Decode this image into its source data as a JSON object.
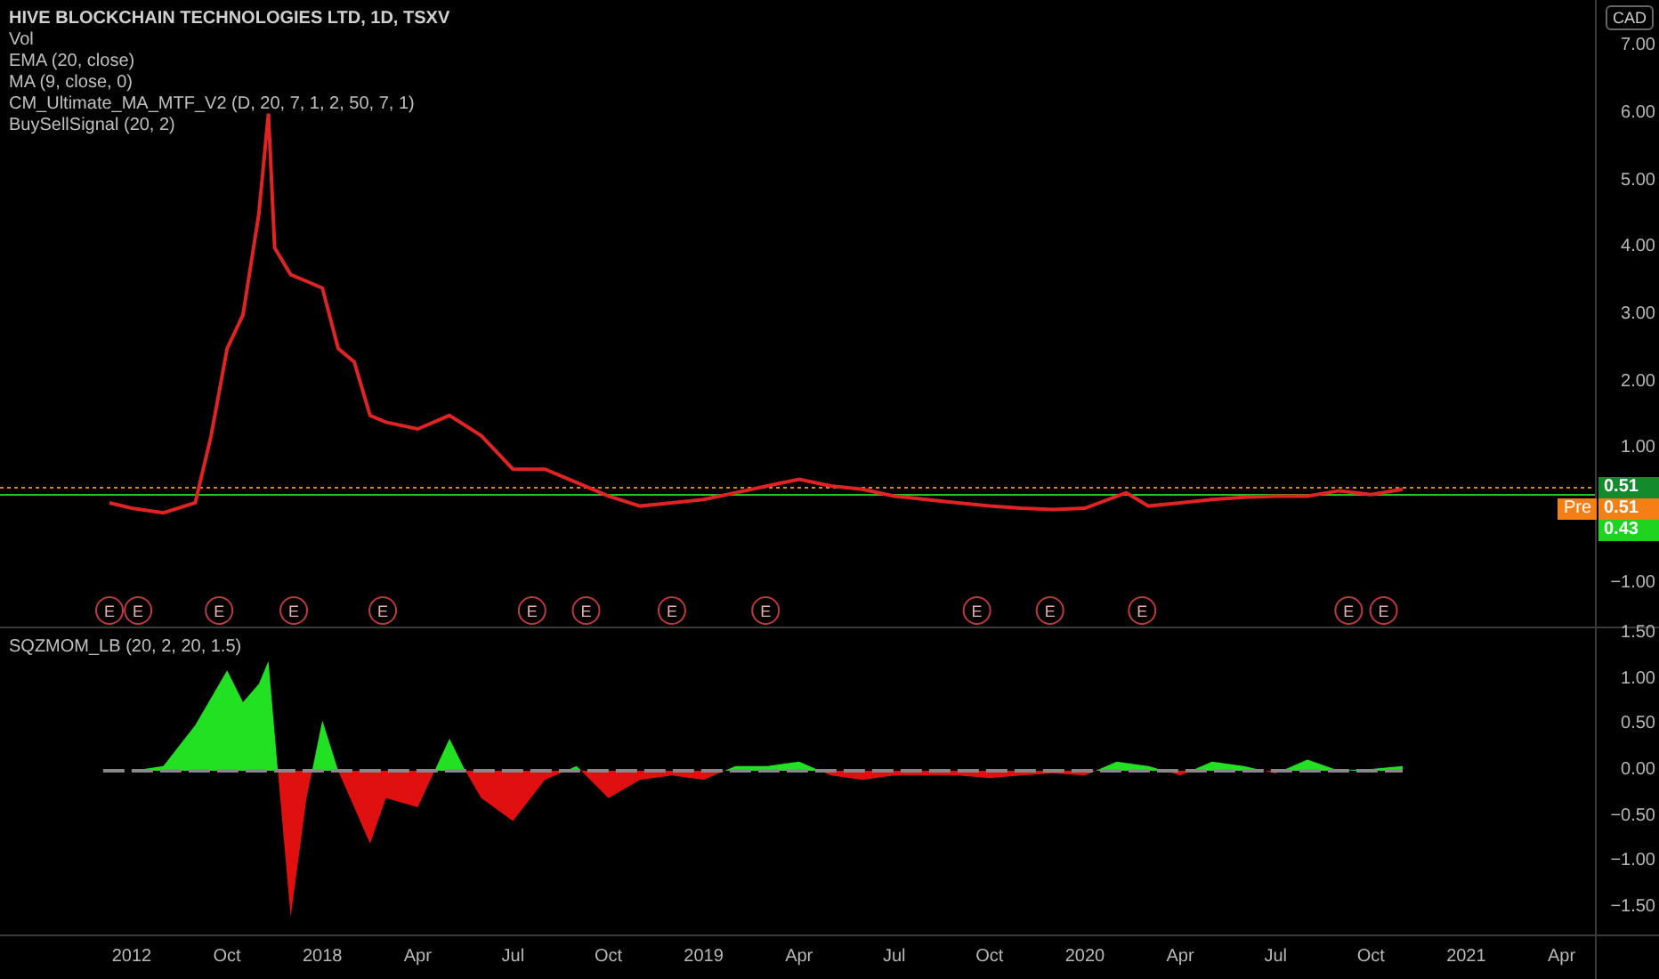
{
  "legend": {
    "title": "HIVE BLOCKCHAIN TECHNOLOGIES LTD, 1D, TSXV",
    "studies": [
      "Vol",
      "EMA (20, close)",
      "MA (9, close, 0)",
      "CM_Ultimate_MA_MTF_V2 (D, 20, 7, 1, 2, 50, 7, 1)",
      "BuySellSignal (20, 2)"
    ]
  },
  "currency": "CAD",
  "price_pane": {
    "axis_labels": [
      "7.00",
      "6.00",
      "5.00",
      "4.00",
      "3.00",
      "2.00",
      "1.00",
      "−1.00"
    ],
    "earnings_markers": [
      {
        "label": "E"
      },
      {
        "label": "E"
      },
      {
        "label": "E"
      },
      {
        "label": "E"
      },
      {
        "label": "E"
      },
      {
        "label": "E"
      },
      {
        "label": "E"
      },
      {
        "label": "E"
      },
      {
        "label": "E"
      },
      {
        "label": "E"
      },
      {
        "label": "E"
      },
      {
        "label": "E"
      },
      {
        "label": "E"
      },
      {
        "label": "E"
      }
    ],
    "price_tags": [
      {
        "value": "0.51",
        "color": "#138a2c"
      },
      {
        "label": "Pre",
        "value": "0.51",
        "color": "#f57f17"
      },
      {
        "value": "0.43",
        "color": "#1fd41f"
      }
    ]
  },
  "momentum_pane": {
    "title": "SQZMOM_LB (20, 2, 20, 1.5)",
    "axis_labels": [
      "1.50",
      "1.00",
      "0.50",
      "0.00",
      "−0.50",
      "−1.00",
      "−1.50"
    ]
  },
  "time_axis": [
    "2012",
    "Oct",
    "2018",
    "Apr",
    "Jul",
    "Oct",
    "2019",
    "Apr",
    "Jul",
    "Oct",
    "2020",
    "Apr",
    "Jul",
    "Oct",
    "2021",
    "Apr"
  ]
}
